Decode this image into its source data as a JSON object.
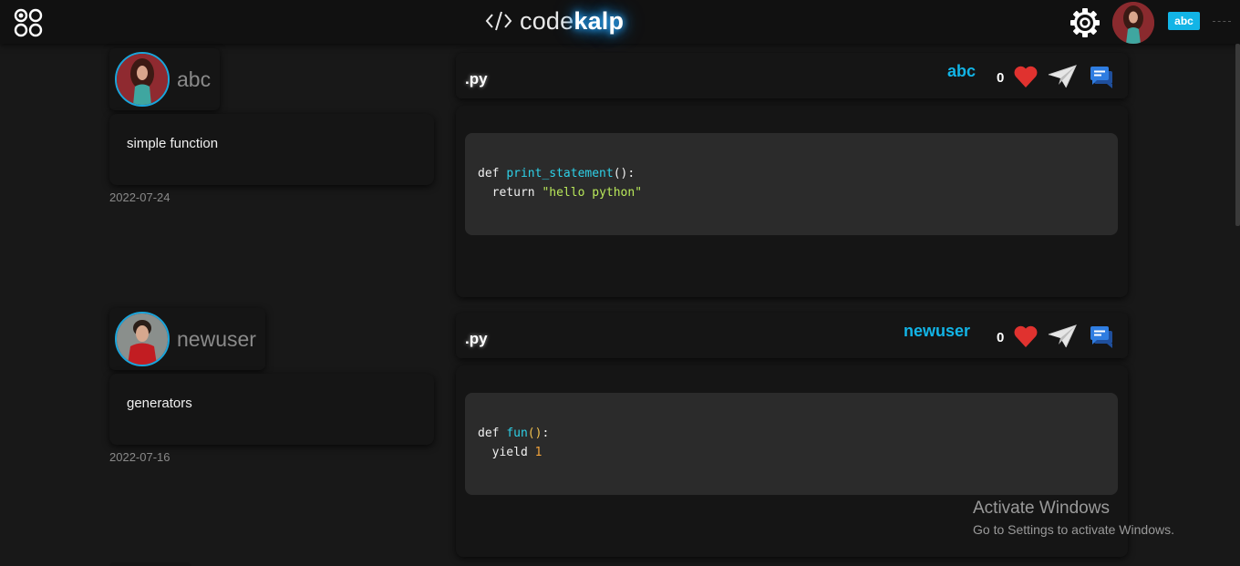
{
  "header": {
    "brand_prefix": "code",
    "brand_suffix": "kalp",
    "user_badge": "abc"
  },
  "posts": [
    {
      "author": "abc",
      "title": "simple function",
      "date": "2022-07-24",
      "lang": ".py",
      "header_user": "abc",
      "likes": "0",
      "code": {
        "l1_kw": "def ",
        "l1_fn": "print_statement",
        "l1_rest": "():",
        "l2_kw": "  return ",
        "l2_str": "\"hello python\""
      }
    },
    {
      "author": "newuser",
      "title": "generators",
      "date": "2022-07-16",
      "lang": ".py",
      "header_user": "newuser",
      "likes": "0",
      "code": {
        "l1_kw": "def ",
        "l1_fn": "fun",
        "l1_paren": "()",
        "l1_rest": ":",
        "l2_kw": "  yield ",
        "l2_num": "1"
      }
    }
  ],
  "watermark": {
    "title": "Activate Windows",
    "subtitle": "Go to Settings to activate Windows."
  },
  "colors": {
    "accent": "#12b4e6",
    "heart": "#e0322f",
    "chat": "#2f7de1",
    "background": "#181818"
  },
  "icons": [
    "menu-grid-icon",
    "code-brackets-icon",
    "gear-icon",
    "heart-icon",
    "paper-plane-icon",
    "chat-icon"
  ]
}
